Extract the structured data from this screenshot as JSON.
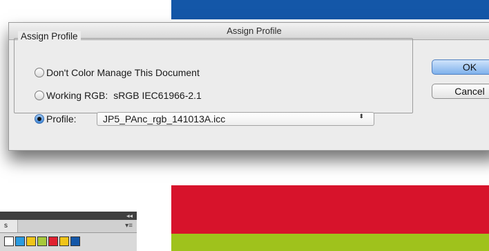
{
  "dialog": {
    "title": "Assign Profile",
    "group_label": "Assign Profile",
    "options": [
      {
        "label": "Don't Color Manage This Document",
        "checked": false
      },
      {
        "label": "Working RGB:",
        "value": "sRGB IEC61966-2.1",
        "checked": false
      },
      {
        "label": "Profile:",
        "checked": true
      }
    ],
    "profile_select": {
      "value": "JP5_PAnc_rgb_141013A.icc",
      "arrows": "⬍"
    },
    "buttons": {
      "ok": "OK",
      "cancel": "Cancel"
    }
  },
  "panel": {
    "collapse_glyph": "◂◂",
    "tab_label": "s",
    "menu_glyph": "▾≡",
    "swatch_colors": [
      "#ffffff",
      "#2b9be0",
      "#f0c419",
      "#a7c93a",
      "#e02030",
      "#f0c419",
      "#1457a8"
    ]
  },
  "colors": {
    "band_top": "#1457a8",
    "band_red": "#d7132b",
    "band_green": "#9fc21c"
  }
}
